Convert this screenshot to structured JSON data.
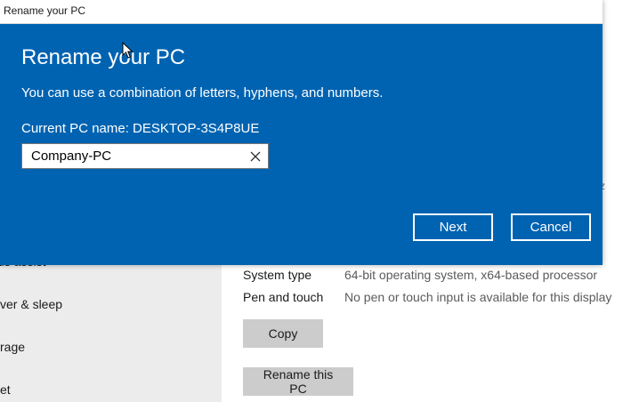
{
  "background": {
    "sidebar": {
      "items": [
        {
          "label": "us assist"
        },
        {
          "label": "ver & sleep"
        },
        {
          "label": "rage"
        },
        {
          "label": "et"
        }
      ]
    },
    "specs": {
      "partial_text": "z",
      "rows": [
        {
          "label": "System type",
          "value": "64-bit operating system, x64-based processor"
        },
        {
          "label": "Pen and touch",
          "value": "No pen or touch input is available for this display"
        }
      ]
    },
    "copy_label": "Copy",
    "rename_label": "Rename this PC"
  },
  "dialog": {
    "window_title": "Rename your PC",
    "title": "Rename your PC",
    "description": "You can use a combination of letters, hyphens, and numbers.",
    "current_name": "Current PC name: DESKTOP-3S4P8UE",
    "input_value": "Company-PC",
    "next_label": "Next",
    "cancel_label": "Cancel"
  },
  "colors": {
    "dialog_accent": "#0063b1",
    "sidebar_bg": "#ececec",
    "gray_button": "#cccccc"
  }
}
